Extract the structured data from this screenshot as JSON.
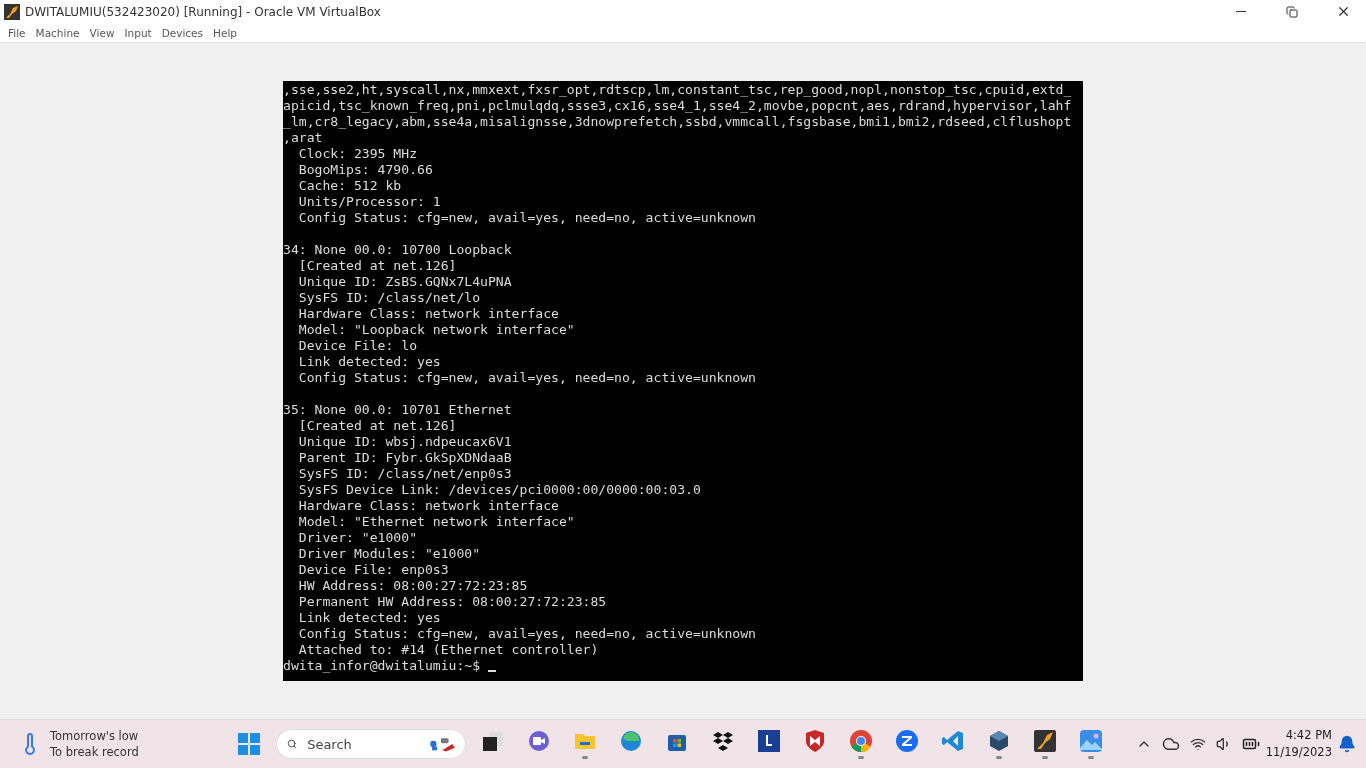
{
  "window": {
    "title": "DWITALUMIU(532423020) [Running] - Oracle VM VirtualBox"
  },
  "menu": [
    "File",
    "Machine",
    "View",
    "Input",
    "Devices",
    "Help"
  ],
  "terminal": {
    "blocks": [
      [
        ",sse,sse2,ht,syscall,nx,mmxext,fxsr_opt,rdtscp,lm,constant_tsc,rep_good,nopl,nonstop_tsc,cpuid,extd_",
        "apicid,tsc_known_freq,pni,pclmulqdq,ssse3,cx16,sse4_1,sse4_2,movbe,popcnt,aes,rdrand,hypervisor,lahf",
        "_lm,cr8_legacy,abm,sse4a,misalignsse,3dnowprefetch,ssbd,vmmcall,fsgsbase,bmi1,bmi2,rdseed,clflushopt",
        ",arat",
        "  Clock: 2395 MHz",
        "  BogoMips: 4790.66",
        "  Cache: 512 kb",
        "  Units/Processor: 1",
        "  Config Status: cfg=new, avail=yes, need=no, active=unknown"
      ],
      [
        "34: None 00.0: 10700 Loopback",
        "  [Created at net.126]",
        "  Unique ID: ZsBS.GQNx7L4uPNA",
        "  SysFS ID: /class/net/lo",
        "  Hardware Class: network interface",
        "  Model: \"Loopback network interface\"",
        "  Device File: lo",
        "  Link detected: yes",
        "  Config Status: cfg=new, avail=yes, need=no, active=unknown"
      ],
      [
        "35: None 00.0: 10701 Ethernet",
        "  [Created at net.126]",
        "  Unique ID: wbsj.ndpeucax6V1",
        "  Parent ID: Fybr.GkSpXDNdaaB",
        "  SysFS ID: /class/net/enp0s3",
        "  SysFS Device Link: /devices/pci0000:00/0000:00:03.0",
        "  Hardware Class: network interface",
        "  Model: \"Ethernet network interface\"",
        "  Driver: \"e1000\"",
        "  Driver Modules: \"e1000\"",
        "  Device File: enp0s3",
        "  HW Address: 08:00:27:72:23:85",
        "  Permanent HW Address: 08:00:27:72:23:85",
        "  Link detected: yes",
        "  Config Status: cfg=new, avail=yes, need=no, active=unknown",
        "  Attached to: #14 (Ethernet controller)"
      ]
    ],
    "prompt": "dwita_infor@dwitalumiu:~$"
  },
  "taskbar": {
    "weather": {
      "title": "Tomorrow's low",
      "subtitle": "To break record"
    },
    "search": {
      "placeholder": "Search"
    },
    "apps": [
      {
        "kind": "taskview",
        "running": false
      },
      {
        "kind": "chat",
        "running": false
      },
      {
        "kind": "folder",
        "running": true
      },
      {
        "kind": "browser-edge",
        "running": false
      },
      {
        "kind": "store",
        "running": false
      },
      {
        "kind": "dropbox",
        "running": false
      },
      {
        "kind": "letter",
        "running": false
      },
      {
        "kind": "shield",
        "running": false
      },
      {
        "kind": "chrome",
        "running": true
      },
      {
        "kind": "zoom",
        "running": false
      },
      {
        "kind": "code",
        "running": false
      },
      {
        "kind": "cube",
        "running": true
      },
      {
        "kind": "vbox",
        "running": true
      },
      {
        "kind": "photos",
        "running": true
      }
    ],
    "time": "4:42 PM",
    "date": "11/19/2023"
  }
}
